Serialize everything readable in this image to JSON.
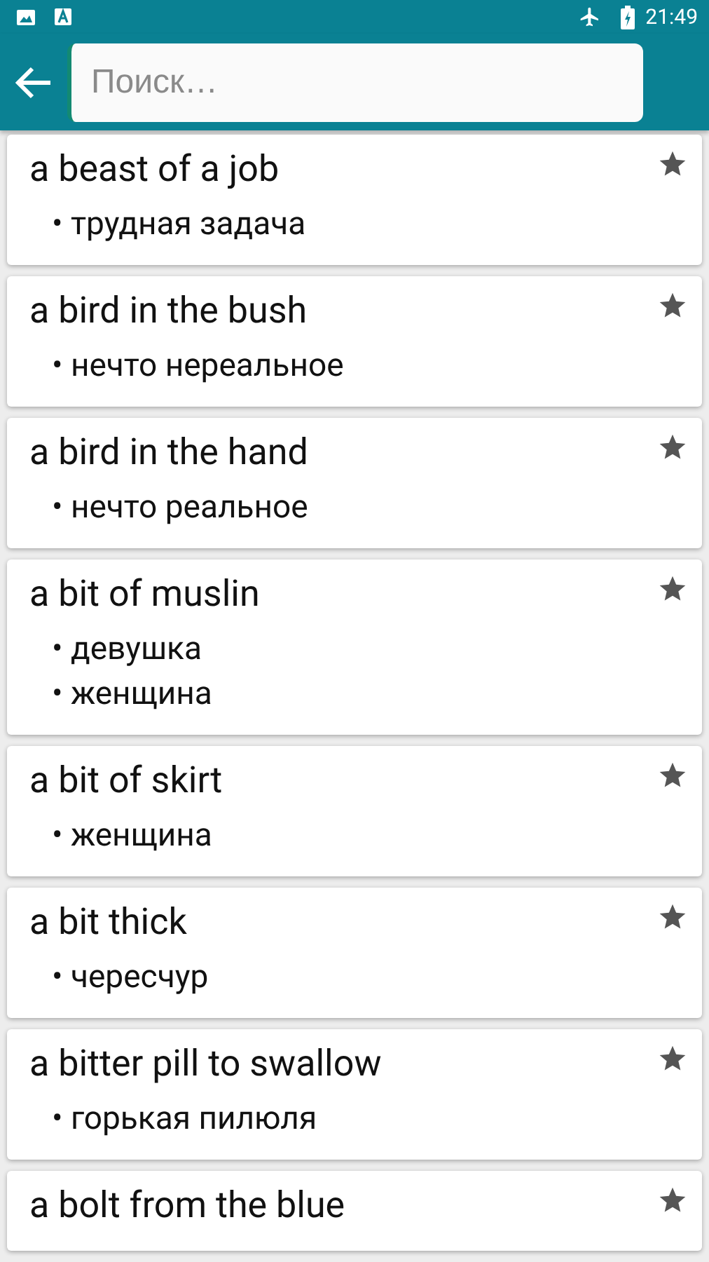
{
  "status_bar": {
    "time": "21:49"
  },
  "search": {
    "placeholder": "Поиск…"
  },
  "entries": [
    {
      "phrase": "a beast of a job",
      "senses": [
        "• трудная задача"
      ]
    },
    {
      "phrase": "a bird in the bush",
      "senses": [
        "• нечто нереальное"
      ]
    },
    {
      "phrase": "a bird in the hand",
      "senses": [
        "• нечто реальное"
      ]
    },
    {
      "phrase": "a bit of muslin",
      "senses": [
        "• девушка",
        "• женщина"
      ]
    },
    {
      "phrase": "a bit of skirt",
      "senses": [
        "• женщина"
      ]
    },
    {
      "phrase": "a bit thick",
      "senses": [
        "• чересчур"
      ]
    },
    {
      "phrase": "a bitter pill to swallow",
      "senses": [
        "• горькая пилюля"
      ]
    },
    {
      "phrase": "a bolt from the blue"
    }
  ]
}
